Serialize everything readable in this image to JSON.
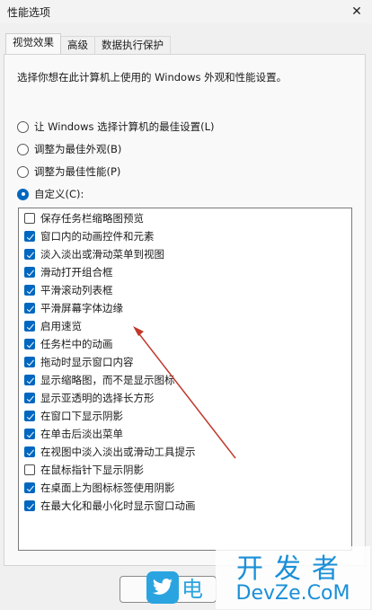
{
  "window": {
    "title": "性能选项",
    "close_glyph": "✕"
  },
  "tabs": [
    {
      "label": "视觉效果",
      "active": true
    },
    {
      "label": "高级",
      "active": false
    },
    {
      "label": "数据执行保护",
      "active": false
    }
  ],
  "description": "选择你想在此计算机上使用的 Windows 外观和性能设置。",
  "radio_options": [
    {
      "label": "让 Windows 选择计算机的最佳设置(L)",
      "selected": false
    },
    {
      "label": "调整为最佳外观(B)",
      "selected": false
    },
    {
      "label": "调整为最佳性能(P)",
      "selected": false
    },
    {
      "label": "自定义(C):",
      "selected": true
    }
  ],
  "effects": [
    {
      "label": "保存任务栏缩略图预览",
      "checked": false
    },
    {
      "label": "窗口内的动画控件和元素",
      "checked": true
    },
    {
      "label": "淡入淡出或滑动菜单到视图",
      "checked": true
    },
    {
      "label": "滑动打开组合框",
      "checked": true
    },
    {
      "label": "平滑滚动列表框",
      "checked": true
    },
    {
      "label": "平滑屏幕字体边缘",
      "checked": true
    },
    {
      "label": "启用速览",
      "checked": true
    },
    {
      "label": "任务栏中的动画",
      "checked": true
    },
    {
      "label": "拖动时显示窗口内容",
      "checked": true
    },
    {
      "label": "显示缩略图，而不是显示图标",
      "checked": true
    },
    {
      "label": "显示亚透明的选择长方形",
      "checked": true
    },
    {
      "label": "在窗口下显示阴影",
      "checked": true
    },
    {
      "label": "在单击后淡出菜单",
      "checked": true
    },
    {
      "label": "在视图中淡入淡出或滑动工具提示",
      "checked": true
    },
    {
      "label": "在鼠标指针下显示阴影",
      "checked": false
    },
    {
      "label": "在桌面上为图标标签使用阴影",
      "checked": true
    },
    {
      "label": "在最大化和最小化时显示窗口动画",
      "checked": true
    }
  ],
  "watermark": {
    "partial_text": "电",
    "cn": "开发者",
    "en": "DevZe.CoM"
  },
  "colors": {
    "accent": "#0067c0",
    "arrow": "#c0392b",
    "watermark": "#1a8fd8"
  }
}
